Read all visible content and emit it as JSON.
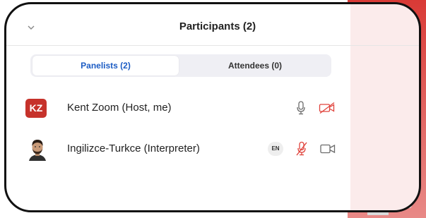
{
  "panel": {
    "title": "Participants (2)"
  },
  "tabs": [
    {
      "label": "Panelists (2)",
      "active": true
    },
    {
      "label": "Attendees (0)",
      "active": false
    }
  ],
  "participants": [
    {
      "initials": "KZ",
      "name": "Kent Zoom (Host, me)",
      "avatar_color": "#c6322b",
      "mic_icon": "microphone-icon",
      "video_icon": "video-off-icon"
    },
    {
      "name": "Ingilizce-Turkce (Interpreter)",
      "language": "EN",
      "mic_icon": "microphone-muted-icon",
      "video_icon": "video-camera-icon"
    }
  ],
  "colors": {
    "accent_blue": "#1c5cc4",
    "muted_red": "#e0433c",
    "brand_red": "#d93a36"
  }
}
